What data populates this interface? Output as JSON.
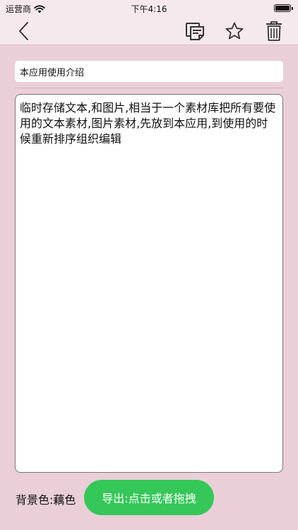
{
  "status": {
    "carrier": "运营商",
    "time": "下午4:16",
    "battery_level": 1.0
  },
  "nav": {
    "icons": {
      "back": "chevron-left-icon",
      "doc": "copy-document-icon",
      "star": "star-icon",
      "trash": "trash-icon"
    },
    "accent_color": "#333333"
  },
  "note": {
    "title": "本应用使用介绍",
    "body": "临时存储文本,和图片,相当于一个素材库把所有要使用的文本素材,图片素材,先放到本应用,到使用的时候重新排序组织编辑"
  },
  "footer": {
    "background_label": "背景色:藕色",
    "export_label": "导出:点击或者拖拽",
    "export_color": "#35c758"
  },
  "colors": {
    "background": "#eacfd9",
    "bar": "#f6e9ee"
  }
}
